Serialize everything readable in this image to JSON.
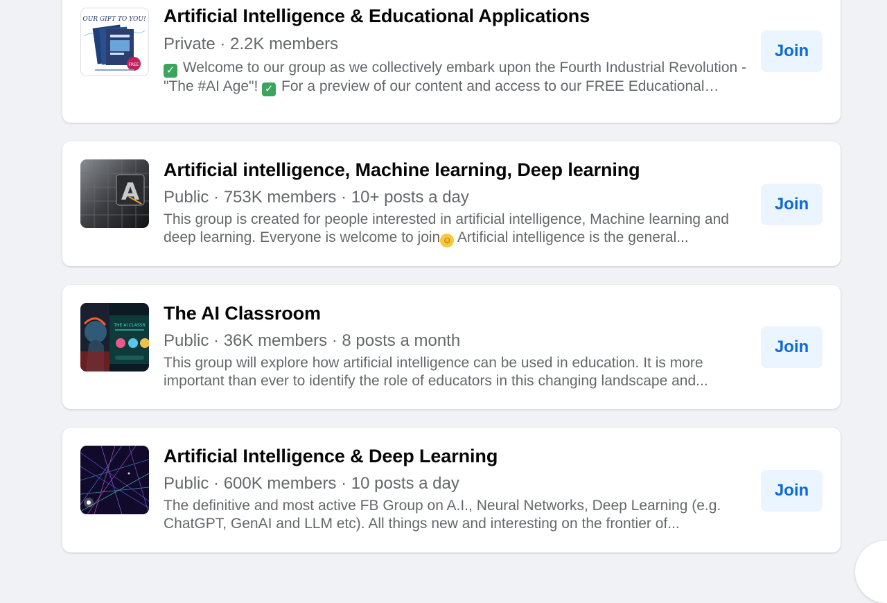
{
  "groups": [
    {
      "name": "Artificial Intelligence & Educational Applications",
      "meta": "Private · 2.2K members",
      "desc_parts": [
        "✓",
        " Welcome to our group as we collectively embark upon the Fourth Industrial Revolution - \"The #AI Age\"! ",
        "✓",
        " For a preview of our content and access to our FREE Educational Technology Integration Framework..."
      ],
      "thumb_text": "OUR GIFT TO YOU!",
      "thumb_badge": "FREE",
      "join_label": "Join"
    },
    {
      "name": "Artificial intelligence, Machine learning, Deep learning",
      "meta": "Public · 753K members · 10+ posts a day",
      "desc_parts": [
        "This group is created for people interested in artificial intelligence, Machine learning and deep learning. Everyone is welcome to join",
        "☺",
        " Artificial intelligence is the general..."
      ],
      "thumb_text": "A",
      "join_label": "Join"
    },
    {
      "name": "The AI Classroom",
      "meta": "Public · 36K members · 8 posts a month",
      "desc": "This group will explore how artificial intelligence can be used in education. It is more important than ever to identify the role of educators in this changing landscape and...",
      "thumb_text": "THE AI CLASSR",
      "join_label": "Join"
    },
    {
      "name": "Artificial Intelligence & Deep Learning",
      "meta": "Public · 600K members · 10 posts a day",
      "desc": "The definitive and most active FB Group on A.I., Neural Networks, Deep Learning (e.g. ChatGPT, GenAI and LLM etc). All things new and interesting on the frontier of...",
      "join_label": "Join"
    }
  ],
  "colors": {
    "page_bg": "#f0f2f5",
    "join_bg": "#ebf5ff",
    "join_text": "#0a6ad6",
    "meta_text": "#65676b",
    "title_text": "#050505"
  },
  "icons": [
    "check-emoji-icon",
    "smile-emoji-icon"
  ]
}
